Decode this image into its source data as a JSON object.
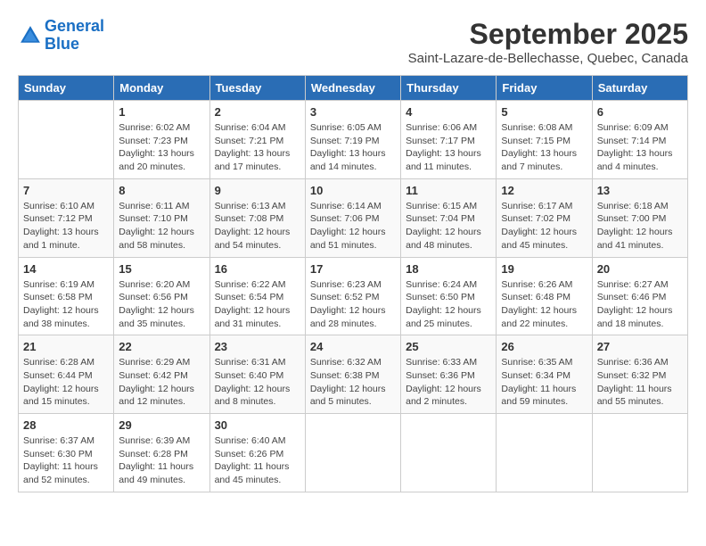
{
  "header": {
    "logo_line1": "General",
    "logo_line2": "Blue",
    "month": "September 2025",
    "location": "Saint-Lazare-de-Bellechasse, Quebec, Canada"
  },
  "weekdays": [
    "Sunday",
    "Monday",
    "Tuesday",
    "Wednesday",
    "Thursday",
    "Friday",
    "Saturday"
  ],
  "weeks": [
    [
      {
        "day": "",
        "info": ""
      },
      {
        "day": "1",
        "info": "Sunrise: 6:02 AM\nSunset: 7:23 PM\nDaylight: 13 hours\nand 20 minutes."
      },
      {
        "day": "2",
        "info": "Sunrise: 6:04 AM\nSunset: 7:21 PM\nDaylight: 13 hours\nand 17 minutes."
      },
      {
        "day": "3",
        "info": "Sunrise: 6:05 AM\nSunset: 7:19 PM\nDaylight: 13 hours\nand 14 minutes."
      },
      {
        "day": "4",
        "info": "Sunrise: 6:06 AM\nSunset: 7:17 PM\nDaylight: 13 hours\nand 11 minutes."
      },
      {
        "day": "5",
        "info": "Sunrise: 6:08 AM\nSunset: 7:15 PM\nDaylight: 13 hours\nand 7 minutes."
      },
      {
        "day": "6",
        "info": "Sunrise: 6:09 AM\nSunset: 7:14 PM\nDaylight: 13 hours\nand 4 minutes."
      }
    ],
    [
      {
        "day": "7",
        "info": "Sunrise: 6:10 AM\nSunset: 7:12 PM\nDaylight: 13 hours\nand 1 minute."
      },
      {
        "day": "8",
        "info": "Sunrise: 6:11 AM\nSunset: 7:10 PM\nDaylight: 12 hours\nand 58 minutes."
      },
      {
        "day": "9",
        "info": "Sunrise: 6:13 AM\nSunset: 7:08 PM\nDaylight: 12 hours\nand 54 minutes."
      },
      {
        "day": "10",
        "info": "Sunrise: 6:14 AM\nSunset: 7:06 PM\nDaylight: 12 hours\nand 51 minutes."
      },
      {
        "day": "11",
        "info": "Sunrise: 6:15 AM\nSunset: 7:04 PM\nDaylight: 12 hours\nand 48 minutes."
      },
      {
        "day": "12",
        "info": "Sunrise: 6:17 AM\nSunset: 7:02 PM\nDaylight: 12 hours\nand 45 minutes."
      },
      {
        "day": "13",
        "info": "Sunrise: 6:18 AM\nSunset: 7:00 PM\nDaylight: 12 hours\nand 41 minutes."
      }
    ],
    [
      {
        "day": "14",
        "info": "Sunrise: 6:19 AM\nSunset: 6:58 PM\nDaylight: 12 hours\nand 38 minutes."
      },
      {
        "day": "15",
        "info": "Sunrise: 6:20 AM\nSunset: 6:56 PM\nDaylight: 12 hours\nand 35 minutes."
      },
      {
        "day": "16",
        "info": "Sunrise: 6:22 AM\nSunset: 6:54 PM\nDaylight: 12 hours\nand 31 minutes."
      },
      {
        "day": "17",
        "info": "Sunrise: 6:23 AM\nSunset: 6:52 PM\nDaylight: 12 hours\nand 28 minutes."
      },
      {
        "day": "18",
        "info": "Sunrise: 6:24 AM\nSunset: 6:50 PM\nDaylight: 12 hours\nand 25 minutes."
      },
      {
        "day": "19",
        "info": "Sunrise: 6:26 AM\nSunset: 6:48 PM\nDaylight: 12 hours\nand 22 minutes."
      },
      {
        "day": "20",
        "info": "Sunrise: 6:27 AM\nSunset: 6:46 PM\nDaylight: 12 hours\nand 18 minutes."
      }
    ],
    [
      {
        "day": "21",
        "info": "Sunrise: 6:28 AM\nSunset: 6:44 PM\nDaylight: 12 hours\nand 15 minutes."
      },
      {
        "day": "22",
        "info": "Sunrise: 6:29 AM\nSunset: 6:42 PM\nDaylight: 12 hours\nand 12 minutes."
      },
      {
        "day": "23",
        "info": "Sunrise: 6:31 AM\nSunset: 6:40 PM\nDaylight: 12 hours\nand 8 minutes."
      },
      {
        "day": "24",
        "info": "Sunrise: 6:32 AM\nSunset: 6:38 PM\nDaylight: 12 hours\nand 5 minutes."
      },
      {
        "day": "25",
        "info": "Sunrise: 6:33 AM\nSunset: 6:36 PM\nDaylight: 12 hours\nand 2 minutes."
      },
      {
        "day": "26",
        "info": "Sunrise: 6:35 AM\nSunset: 6:34 PM\nDaylight: 11 hours\nand 59 minutes."
      },
      {
        "day": "27",
        "info": "Sunrise: 6:36 AM\nSunset: 6:32 PM\nDaylight: 11 hours\nand 55 minutes."
      }
    ],
    [
      {
        "day": "28",
        "info": "Sunrise: 6:37 AM\nSunset: 6:30 PM\nDaylight: 11 hours\nand 52 minutes."
      },
      {
        "day": "29",
        "info": "Sunrise: 6:39 AM\nSunset: 6:28 PM\nDaylight: 11 hours\nand 49 minutes."
      },
      {
        "day": "30",
        "info": "Sunrise: 6:40 AM\nSunset: 6:26 PM\nDaylight: 11 hours\nand 45 minutes."
      },
      {
        "day": "",
        "info": ""
      },
      {
        "day": "",
        "info": ""
      },
      {
        "day": "",
        "info": ""
      },
      {
        "day": "",
        "info": ""
      }
    ]
  ]
}
